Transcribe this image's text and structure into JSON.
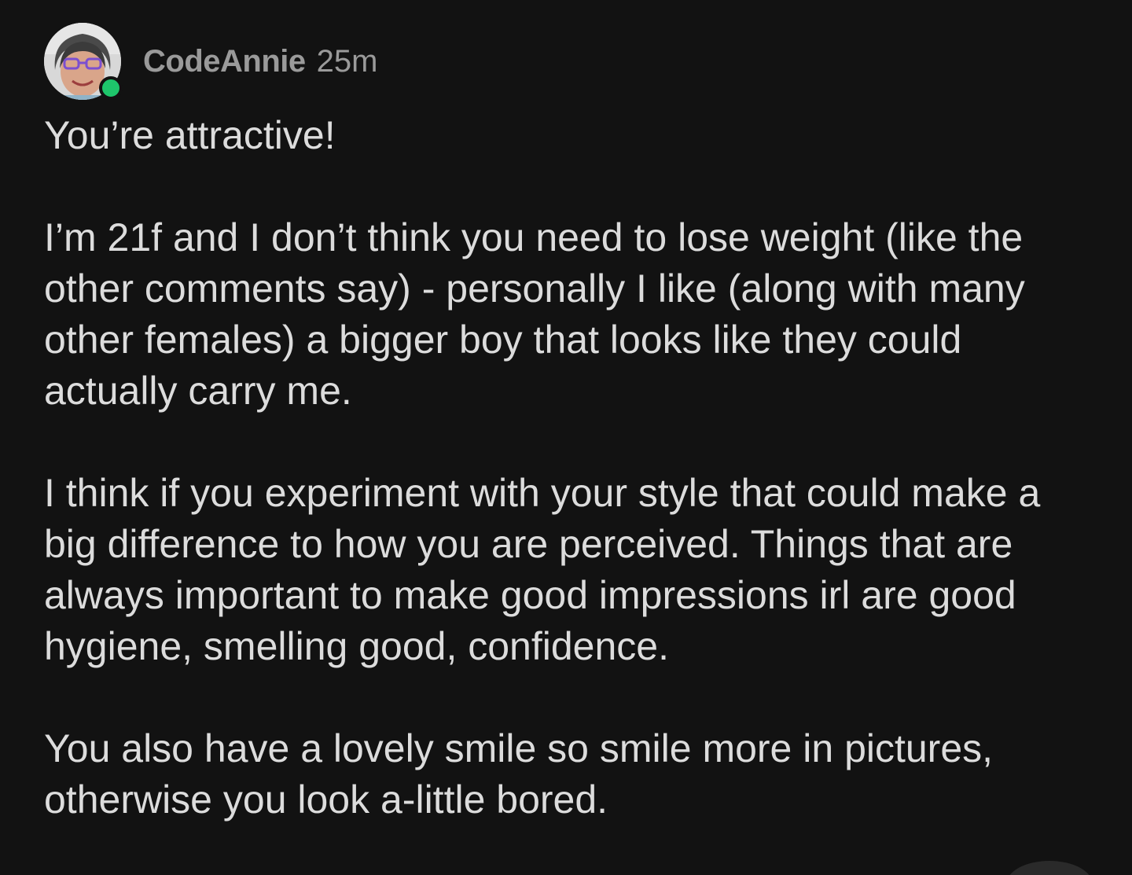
{
  "comment": {
    "author": {
      "username": "CodeAnnie",
      "avatar_icon": "user-avatar-photo",
      "online": true,
      "online_color": "#1ec66b"
    },
    "timestamp": "25m",
    "paragraphs": [
      "You’re attractive!",
      "I’m 21f and I don’t think you need to lose weight (like the other comments say) - personally I like (along with many other females) a bigger boy that looks like they could actually carry me.",
      "I think if you experiment with your style that could make a big difference to how you are perceived. Things that are always important to make good impressions irl are good hygiene, smelling good, confidence.",
      "You also have a lovely smile so smile more in pictures, otherwise you look a-little bored."
    ]
  },
  "colors": {
    "background": "#121212",
    "text": "#dcdcdc",
    "meta_text": "#9a9a9a"
  }
}
